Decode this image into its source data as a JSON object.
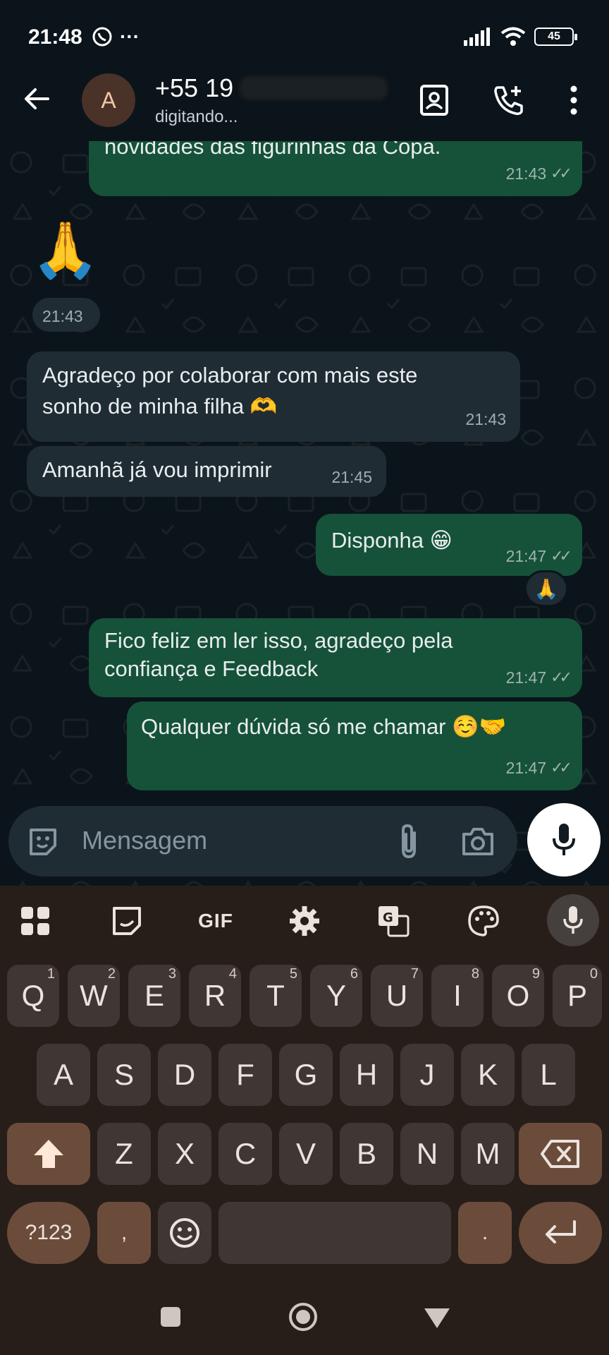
{
  "status_bar": {
    "time": "21:48",
    "dots": "···",
    "battery": "45"
  },
  "header": {
    "avatar_letter": "A",
    "contact_name": "+55 19",
    "contact_status": "digitando..."
  },
  "messages": [
    {
      "id": "m1",
      "direction": "out",
      "text": "novidades das figurinhas da Copa.",
      "time": "21:43",
      "read_ticks": "✓✓"
    },
    {
      "id": "m2",
      "direction": "in",
      "emoji": "🙏",
      "time": "21:43"
    },
    {
      "id": "m3",
      "direction": "in",
      "text_line1": "Agradeço por colaborar com mais este",
      "text_line2": "sonho de minha filha 🫶",
      "time": "21:43"
    },
    {
      "id": "m4",
      "direction": "in",
      "text": "Amanhã já vou imprimir",
      "time": "21:45"
    },
    {
      "id": "m5",
      "direction": "out",
      "text": "Disponha 😁",
      "time": "21:47",
      "read_ticks": "✓✓",
      "reaction": "🙏"
    },
    {
      "id": "m6",
      "direction": "out",
      "text_line1": "Fico feliz em ler isso, agradeço pela",
      "text_line2": "confiança e Feedback",
      "time": "21:47",
      "read_ticks": "✓✓"
    },
    {
      "id": "m7",
      "direction": "out",
      "text": "Qualquer dúvida só me chamar ☺️🤝",
      "time": "21:47",
      "read_ticks": "✓✓"
    }
  ],
  "composer": {
    "placeholder": "Mensagem"
  },
  "keyboard": {
    "toolbar": {
      "gif_label": "GIF"
    },
    "row1": [
      {
        "label": "Q",
        "hint": "1"
      },
      {
        "label": "W",
        "hint": "2"
      },
      {
        "label": "E",
        "hint": "3"
      },
      {
        "label": "R",
        "hint": "4"
      },
      {
        "label": "T",
        "hint": "5"
      },
      {
        "label": "Y",
        "hint": "6"
      },
      {
        "label": "U",
        "hint": "7"
      },
      {
        "label": "I",
        "hint": "8"
      },
      {
        "label": "O",
        "hint": "9"
      },
      {
        "label": "P",
        "hint": "0"
      }
    ],
    "row2": [
      "A",
      "S",
      "D",
      "F",
      "G",
      "H",
      "J",
      "K",
      "L"
    ],
    "row3": [
      "Z",
      "X",
      "C",
      "V",
      "B",
      "N",
      "M"
    ],
    "symbols_label": "?123",
    "comma_label": ",",
    "period_label": "."
  },
  "colors": {
    "background": "#0b141a",
    "incoming_bubble": "#202c33",
    "outgoing_bubble": "#155239",
    "keyboard_bg": "#271e1a",
    "special_key": "#6b4c3b"
  },
  "icons": [
    "back-arrow-icon",
    "contact-card-icon",
    "add-call-icon",
    "more-vert-icon",
    "sticker-icon",
    "attach-icon",
    "camera-icon",
    "mic-icon",
    "apps-grid-icon",
    "gif-icon",
    "settings-gear-icon",
    "translate-icon",
    "palette-icon",
    "shift-icon",
    "backspace-icon",
    "emoji-icon",
    "enter-icon"
  ]
}
